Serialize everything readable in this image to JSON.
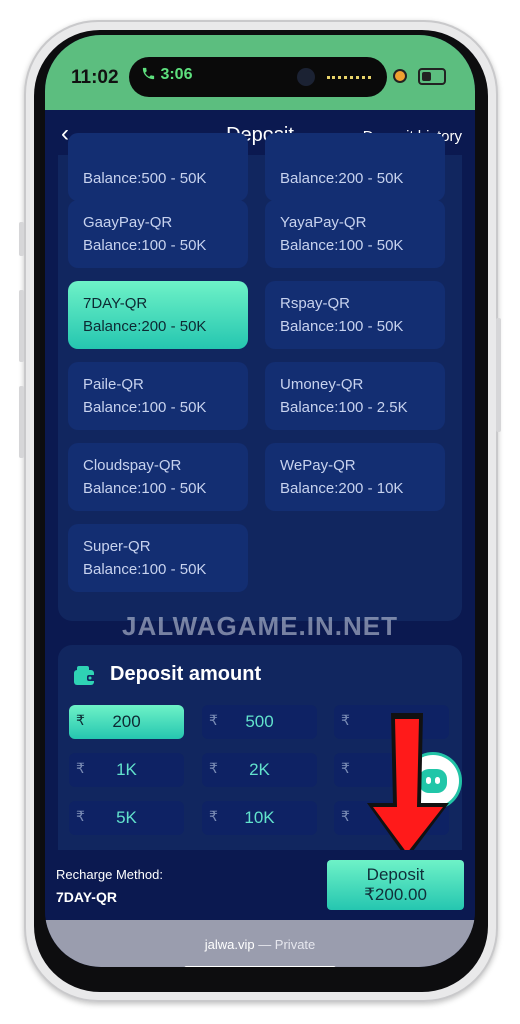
{
  "status_bar": {
    "time": "11:02",
    "call_time": "3:06",
    "call_icon": "phone-icon",
    "colors": {
      "background": "#5cbe7f"
    }
  },
  "header": {
    "back_icon": "chevron-left-icon",
    "back_label": "‹",
    "title": "Deposit",
    "history_label": "Deposit history"
  },
  "channels": [
    {
      "name": "",
      "balance": "Balance:500 - 50K",
      "selected": false
    },
    {
      "name": "",
      "balance": "Balance:200 - 50K",
      "selected": false
    },
    {
      "name": "GaayPay-QR",
      "balance": "Balance:100 - 50K",
      "selected": false
    },
    {
      "name": "YayaPay-QR",
      "balance": "Balance:100 - 50K",
      "selected": false
    },
    {
      "name": "7DAY-QR",
      "balance": "Balance:200 - 50K",
      "selected": true
    },
    {
      "name": "Rspay-QR",
      "balance": "Balance:100 - 50K",
      "selected": false
    },
    {
      "name": "Paile-QR",
      "balance": "Balance:100 - 50K",
      "selected": false
    },
    {
      "name": "Umoney-QR",
      "balance": "Balance:100 - 2.5K",
      "selected": false
    },
    {
      "name": "Cloudspay-QR",
      "balance": "Balance:100 - 50K",
      "selected": false
    },
    {
      "name": "WePay-QR",
      "balance": "Balance:200 - 10K",
      "selected": false
    },
    {
      "name": "Super-QR",
      "balance": "Balance:100 - 50K",
      "selected": false
    }
  ],
  "watermark": "JALWAGAME.IN.NET",
  "deposit_amount": {
    "title": "Deposit amount",
    "icon": "wallet-icon",
    "currency": "₹",
    "chips": [
      {
        "value": "200",
        "selected": true
      },
      {
        "value": "500",
        "selected": false
      },
      {
        "value": "",
        "selected": false
      },
      {
        "value": "1K",
        "selected": false
      },
      {
        "value": "2K",
        "selected": false
      },
      {
        "value": "",
        "selected": false
      },
      {
        "value": "5K",
        "selected": false
      },
      {
        "value": "10K",
        "selected": false
      },
      {
        "value": "",
        "selected": false
      }
    ]
  },
  "floating": {
    "icon": "chat-robot-icon"
  },
  "annotation": {
    "icon": "red-arrow-icon",
    "color": "#ff1a1a"
  },
  "footer": {
    "method_label": "Recharge Method:",
    "method_value": "7DAY-QR",
    "deposit_button": "Deposit ₹200.00"
  },
  "browser": {
    "domain": "jalwa.vip",
    "mode": " — Private"
  },
  "colors": {
    "background": "#0b1950",
    "panel": "#11265f",
    "card": "#132e72",
    "accent": "#25c6b0"
  }
}
